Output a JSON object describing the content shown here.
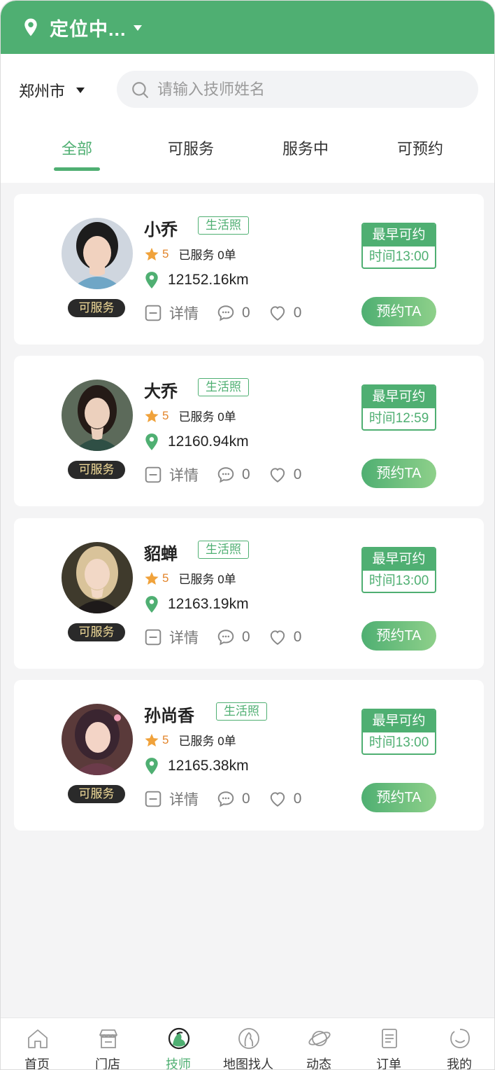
{
  "header": {
    "location_text": "定位中..."
  },
  "search_row": {
    "city": "郑州市",
    "search_placeholder": "请输入技师姓名"
  },
  "tabs": [
    {
      "label": "全部",
      "active": true
    },
    {
      "label": "可服务",
      "active": false
    },
    {
      "label": "服务中",
      "active": false
    },
    {
      "label": "可预约",
      "active": false
    }
  ],
  "technicians": [
    {
      "name": "小乔",
      "tag": "生活照",
      "status": "可服务",
      "rating": "5",
      "served": "已服务 0单",
      "distance": "12152.16km",
      "detail_label": "详情",
      "comments": "0",
      "likes": "0",
      "earliest_label": "最早可约",
      "earliest_time": "时间13:00",
      "book_label": "预约TA"
    },
    {
      "name": "大乔",
      "tag": "生活照",
      "status": "可服务",
      "rating": "5",
      "served": "已服务 0单",
      "distance": "12160.94km",
      "detail_label": "详情",
      "comments": "0",
      "likes": "0",
      "earliest_label": "最早可约",
      "earliest_time": "时间12:59",
      "book_label": "预约TA"
    },
    {
      "name": "貂蝉",
      "tag": "生活照",
      "status": "可服务",
      "rating": "5",
      "served": "已服务 0单",
      "distance": "12163.19km",
      "detail_label": "详情",
      "comments": "0",
      "likes": "0",
      "earliest_label": "最早可约",
      "earliest_time": "时间13:00",
      "book_label": "预约TA"
    },
    {
      "name": "孙尚香",
      "tag": "生活照",
      "status": "可服务",
      "rating": "5",
      "served": "已服务 0单",
      "distance": "12165.38km",
      "detail_label": "详情",
      "comments": "0",
      "likes": "0",
      "earliest_label": "最早可约",
      "earliest_time": "时间13:00",
      "book_label": "预约TA"
    }
  ],
  "bottom_nav": [
    {
      "label": "首页",
      "icon": "home-icon",
      "active": false
    },
    {
      "label": "门店",
      "icon": "store-icon",
      "active": false
    },
    {
      "label": "技师",
      "icon": "technician-icon",
      "active": true
    },
    {
      "label": "地图找人",
      "icon": "map-person-icon",
      "active": false
    },
    {
      "label": "动态",
      "icon": "planet-icon",
      "active": false
    },
    {
      "label": "订单",
      "icon": "order-icon",
      "active": false
    },
    {
      "label": "我的",
      "icon": "profile-icon",
      "active": false
    }
  ],
  "colors": {
    "primary": "#4faf72",
    "star": "#e3852b",
    "status_bg": "#2a2a2a",
    "status_text": "#f3dd9a",
    "background": "#f4f4f5"
  }
}
